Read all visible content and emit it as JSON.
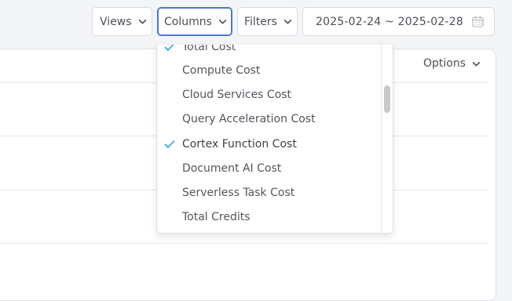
{
  "toolbar": {
    "views_label": "Views",
    "columns_label": "Columns",
    "filters_label": "Filters",
    "date_range": "2025-02-24 ~ 2025-02-28"
  },
  "panel": {
    "options_label": "Options"
  },
  "columns_menu": {
    "items": [
      {
        "label": "Total Cost",
        "checked": true
      },
      {
        "label": "Compute Cost",
        "checked": false
      },
      {
        "label": "Cloud Services Cost",
        "checked": false
      },
      {
        "label": "Query Acceleration Cost",
        "checked": false
      },
      {
        "label": "Cortex Function Cost",
        "checked": true
      },
      {
        "label": "Document AI Cost",
        "checked": false
      },
      {
        "label": "Serverless Task Cost",
        "checked": false
      },
      {
        "label": "Total Credits",
        "checked": false
      }
    ]
  },
  "colors": {
    "check": "#2f9fd6",
    "focus_border": "#4a78c8"
  },
  "icons": {
    "chevron": "chevron-down-icon",
    "calendar": "calendar-icon",
    "check": "check-icon"
  }
}
